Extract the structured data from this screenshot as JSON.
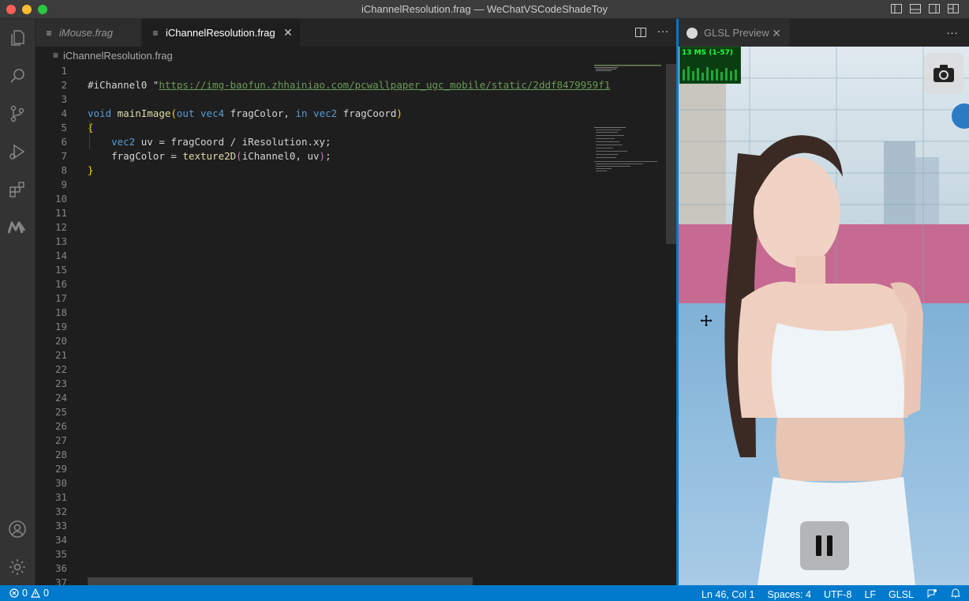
{
  "window": {
    "title": "iChannelResolution.frag — WeChatVSCodeShadeToy"
  },
  "editor": {
    "tabs": [
      {
        "label": "iMouse.frag"
      },
      {
        "label": "iChannelResolution.frag"
      }
    ],
    "breadcrumb": "iChannelResolution.frag",
    "lines": {
      "l1_a": "#iChannel0 \"",
      "l1_url": "https://img-baofun.zhhainiao.com/pcwallpaper_ugc_mobile/static/2ddf8479959f1",
      "l3_void": "void",
      "l3_name": "mainImage",
      "l3_out": "out",
      "l3_vec4": "vec4",
      "l3_fragColor": "fragColor,",
      "l3_in": "in",
      "l3_vec2": "vec2",
      "l3_fragCoord": "fragCoord",
      "l4": "{",
      "l5_type": "vec2",
      "l5_rest": "uv = fragCoord / iResolution.xy;",
      "l6_a": "fragColor = ",
      "l6_fn": "texture2D",
      "l6_args": "iChannel0, uv",
      "l6_end": ";",
      "l7": "}"
    },
    "line_count": 37
  },
  "preview": {
    "tab_label": "GLSL Preview",
    "fps_text": "13 MS (1-57)"
  },
  "statusbar": {
    "errors": "0",
    "warnings": "0",
    "position": "Ln 46, Col 1",
    "spaces": "Spaces: 4",
    "encoding": "UTF-8",
    "eol": "LF",
    "language": "GLSL"
  },
  "icons": {
    "activity": [
      "explorer-icon",
      "search-icon",
      "source-control-icon",
      "run-debug-icon",
      "extensions-icon",
      "marketplace-m-icon",
      "account-icon",
      "settings-gear-icon"
    ]
  },
  "colors": {
    "accent": "#007acc",
    "keyword": "#569cd6",
    "function": "#dcdcaa",
    "comment_url": "#6a9955"
  }
}
